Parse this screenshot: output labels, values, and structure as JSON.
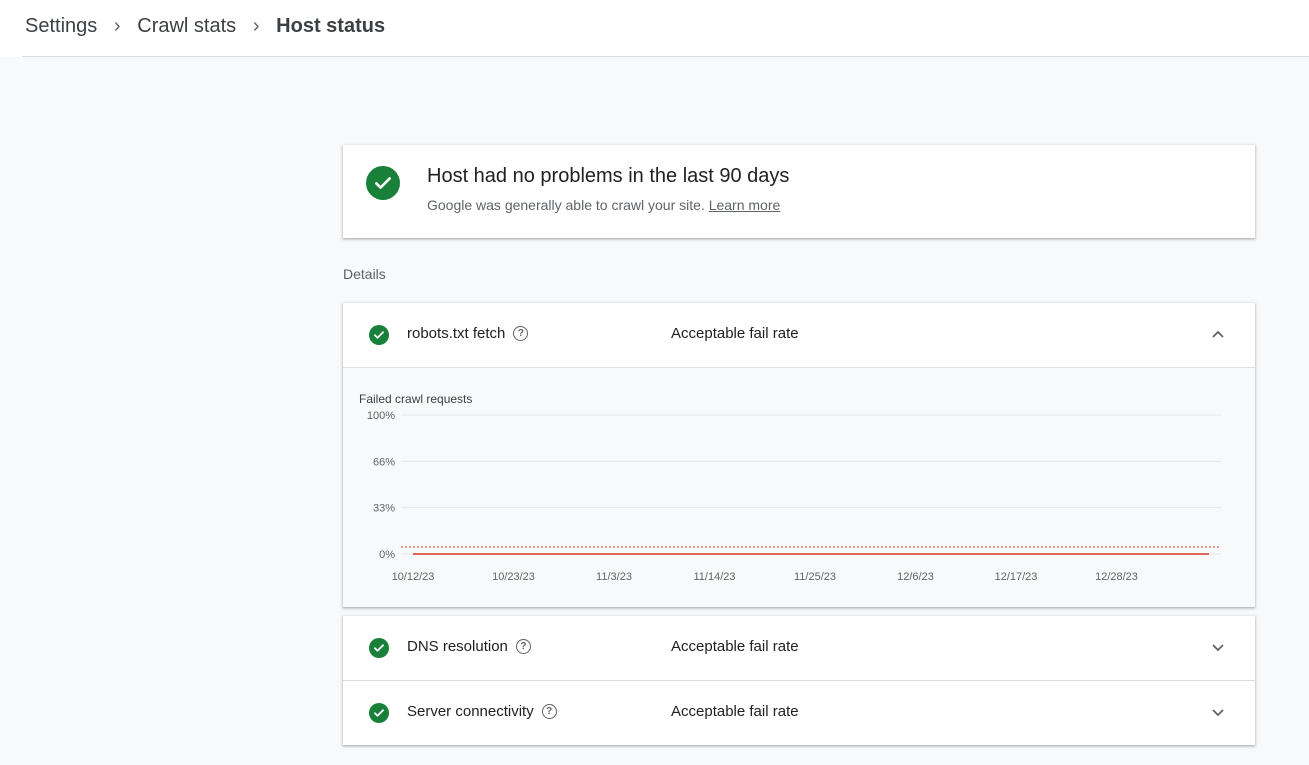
{
  "breadcrumb": {
    "items": [
      "Settings",
      "Crawl stats"
    ],
    "current": "Host status"
  },
  "summary": {
    "title": "Host had no problems in the last 90 days",
    "subtitle": "Google was generally able to crawl your site.",
    "link": "Learn more",
    "icon": "check-circle-icon"
  },
  "details_label": "Details",
  "rows": [
    {
      "name": "robots.txt fetch",
      "status": "Acceptable fail rate",
      "expanded": true
    },
    {
      "name": "DNS resolution",
      "status": "Acceptable fail rate",
      "expanded": false
    },
    {
      "name": "Server connectivity",
      "status": "Acceptable fail rate",
      "expanded": false
    }
  ],
  "colors": {
    "success": "#188038",
    "line": "#d93025",
    "threshold": "#d93025"
  },
  "chart_data": {
    "type": "line",
    "title": "Failed crawl requests",
    "ylabel": "",
    "xlabel": "",
    "y_ticks": [
      "100%",
      "66%",
      "33%",
      "0%"
    ],
    "ylim": [
      0,
      100
    ],
    "x_ticks": [
      "10/12/23",
      "10/23/23",
      "11/3/23",
      "11/14/23",
      "11/25/23",
      "12/6/23",
      "12/17/23",
      "12/28/23"
    ],
    "series": [
      {
        "values": [
          0,
          0,
          0,
          0,
          0,
          0,
          0,
          0
        ]
      }
    ],
    "threshold": 5,
    "grid": true
  }
}
